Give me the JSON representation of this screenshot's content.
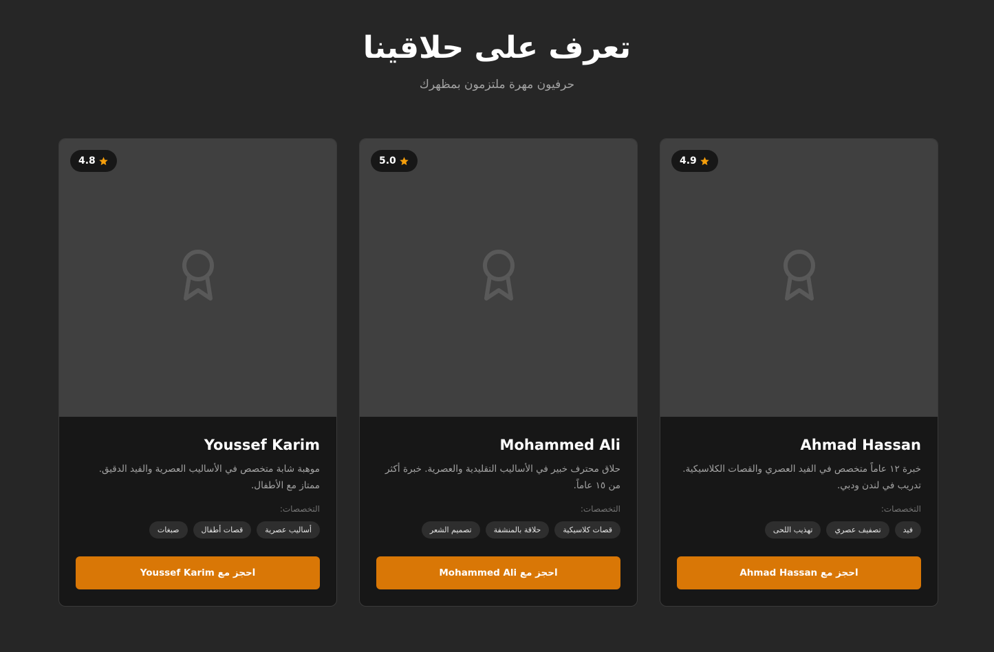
{
  "header": {
    "title": "تعرف على حلاقينا",
    "subtitle": "حرفيون مهرة ملتزمون بمظهرك"
  },
  "colors": {
    "accent": "#d97706",
    "star": "#f59e0b",
    "background": "#262626",
    "card": "#171717",
    "photo_placeholder": "#404040"
  },
  "cards": [
    {
      "name": "Ahmad Hassan",
      "rating": "4.9",
      "rating_icon": "star-icon",
      "photo_icon": "award-icon",
      "bio": "خبرة ١٢ عاماً متخصص في الفيد العصري والقصات الكلاسيكية. تدريب في لندن ودبي.",
      "specialties_label": "التخصصات:",
      "tags": [
        "فيد",
        "تصفيف عصري",
        "تهذيب اللحى"
      ],
      "button_label": "احجز مع Ahmad Hassan"
    },
    {
      "name": "Mohammed Ali",
      "rating": "5.0",
      "rating_icon": "star-icon",
      "photo_icon": "award-icon",
      "bio": "حلاق محترف خبير في الأساليب التقليدية والعصرية. خبرة أكثر من ١٥ عاماً.",
      "specialties_label": "التخصصات:",
      "tags": [
        "قصات كلاسيكية",
        "حلاقة بالمنشفة",
        "تصميم الشعر"
      ],
      "button_label": "احجز مع Mohammed Ali"
    },
    {
      "name": "Youssef Karim",
      "rating": "4.8",
      "rating_icon": "star-icon",
      "photo_icon": "award-icon",
      "bio": "موهبة شابة متخصص في الأساليب العصرية والفيد الدقيق. ممتاز مع الأطفال.",
      "specialties_label": "التخصصات:",
      "tags": [
        "أساليب عصرية",
        "قصات أطفال",
        "صبغات"
      ],
      "button_label": "احجز مع Youssef Karim"
    }
  ]
}
